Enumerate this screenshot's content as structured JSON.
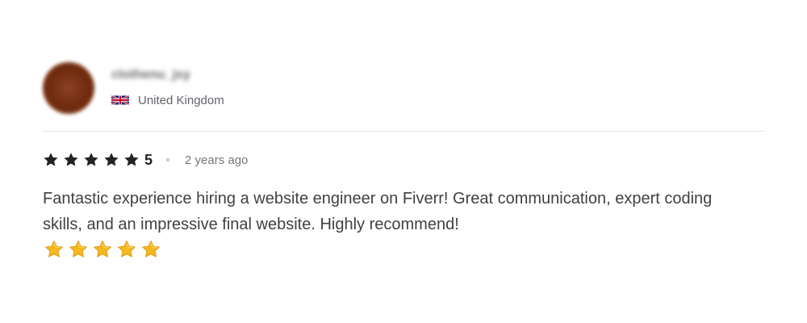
{
  "reviewer": {
    "username": "clothenu_jsy",
    "country": "United Kingdom",
    "flag_icon": "uk-flag-icon"
  },
  "rating": {
    "stars": 5,
    "max_stars": 5,
    "score_label": "5",
    "time_ago": "2 years ago",
    "star_color": "#222325"
  },
  "review": {
    "text": "Fantastic experience hiring a website engineer on Fiverr! Great communication, expert coding skills, and an impressive final website. Highly recommend!",
    "emoji_stars": 5,
    "emoji_icon": "star-emoji-icon",
    "emoji_color": "#f5b820"
  }
}
